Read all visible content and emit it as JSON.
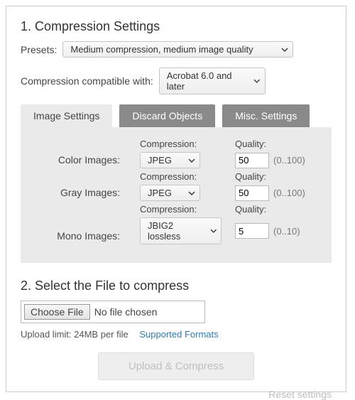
{
  "section1": {
    "title": "1. Compression Settings",
    "presets_label": "Presets:",
    "presets_value": "Medium compression, medium image quality",
    "compat_label": "Compression compatible with:",
    "compat_value": "Acrobat 6.0 and later",
    "tabs": {
      "image": "Image Settings",
      "discard": "Discard Objects",
      "misc": "Misc. Settings"
    },
    "colhead": {
      "compression": "Compression:",
      "quality": "Quality:"
    },
    "rows": {
      "color": {
        "label": "Color Images:",
        "compression": "JPEG",
        "quality": "50",
        "hint": "(0..100)"
      },
      "gray": {
        "label": "Gray Images:",
        "compression": "JPEG",
        "quality": "50",
        "hint": "(0..100)"
      },
      "mono": {
        "label": "Mono Images:",
        "compression": "JBIG2 lossless",
        "quality": "5",
        "hint": "(0..10)"
      }
    }
  },
  "section2": {
    "title": "2. Select the File to compress",
    "choose_label": "Choose File",
    "no_file": "No file chosen",
    "limit": "Upload limit: 24MB per file",
    "formats_link": "Supported Formats",
    "submit": "Upload & Compress",
    "reset": "Reset settings"
  }
}
